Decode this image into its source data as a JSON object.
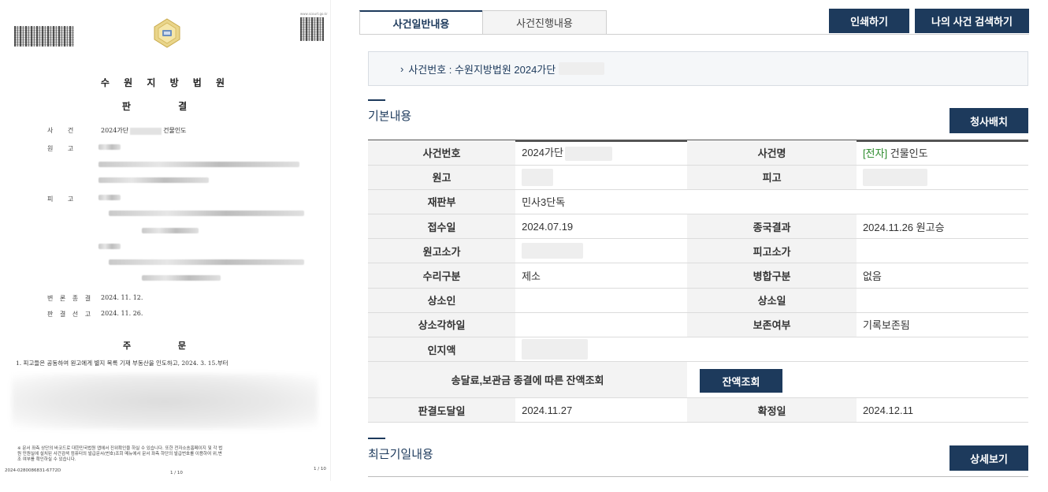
{
  "document": {
    "court_title": "수 원 지 방 법 원",
    "doc_type": "판 결",
    "labels": {
      "case": "사 건",
      "plaintiff": "원 고",
      "defendant": "피 고",
      "hearing_end": "변 론 종 결",
      "judgment_date": "판 결 선 고",
      "order_heading": "주 문"
    },
    "case_number_prefix": "2024가단",
    "case_name": "건물인도",
    "hearing_end_date": "2024. 11. 12.",
    "judgment_date": "2024. 11. 26.",
    "order_line_1": "1. 피고들은 공동하여 원고에게 별지 목록 기재 부동산을 인도하고, 2024. 3. 15.부터",
    "footer_notice": "※ 문서 좌측 상단의 바코드로 대한민국법원 앱에서 진위확인을 하실 수 있습니다. 또한 전자소송홈페이지 및 각 법",
    "footer_notice_2": "원 민원실에 설치된 사건검색 컴퓨터의 발급문서(번호)조회 메뉴에서 문서 좌측 하단의 발급번호를 이용하여 위,변",
    "footer_notice_3": "조 여부를 확인하실 수 있습니다.",
    "issue_number": "2024-0280086831-6772D",
    "page_center": "1 / 10",
    "page_right": "1 / 10",
    "site_url": "www.scourt.go.kr"
  },
  "tabs": [
    {
      "label": "사건일반내용",
      "active": true
    },
    {
      "label": "사건진행내용",
      "active": false
    }
  ],
  "toolbar": {
    "print_label": "인쇄하기",
    "mycase_label": "나의 사건 검색하기"
  },
  "case_header": {
    "bullet": "›",
    "text": "사건번호 : 수원지방법원 2024가단"
  },
  "basic_section": {
    "title": "기본내용",
    "button_label": "청사배치"
  },
  "table": {
    "rows": [
      {
        "l1": "사건번호",
        "v1": "2024가단",
        "l2": "사건명",
        "v2_tag": "[전자]",
        "v2": " 건물인도"
      },
      {
        "l1": "원고",
        "v1": "",
        "l2": "피고",
        "v2": ""
      },
      {
        "l1": "재판부",
        "v1": "민사3단독",
        "l2": "",
        "v2": ""
      },
      {
        "l1": "접수일",
        "v1": "2024.07.19",
        "l2": "종국결과",
        "v2": "2024.11.26 원고승"
      },
      {
        "l1": "원고소가",
        "v1": "",
        "l2": "피고소가",
        "v2": ""
      },
      {
        "l1": "수리구분",
        "v1": "제소",
        "l2": "병합구분",
        "v2": "없음"
      },
      {
        "l1": "상소인",
        "v1": "",
        "l2": "상소일",
        "v2": ""
      },
      {
        "l1": "상소각하일",
        "v1": "",
        "l2": "보존여부",
        "v2": "기록보존됨"
      },
      {
        "l1": "인지액",
        "v1": "",
        "l2": "",
        "v2": ""
      }
    ],
    "balance_label": "송달료,보관금 종결에 따른 잔액조회",
    "balance_button": "잔액조회",
    "final_row": {
      "l1": "판결도달일",
      "v1": "2024.11.27",
      "l2": "확정일",
      "v2": "2024.12.11"
    }
  },
  "recent_section": {
    "title": "최근기일내용",
    "button_label": "상세보기"
  },
  "colors": {
    "navy": "#1d3a5c",
    "green": "#2a8a2a"
  }
}
